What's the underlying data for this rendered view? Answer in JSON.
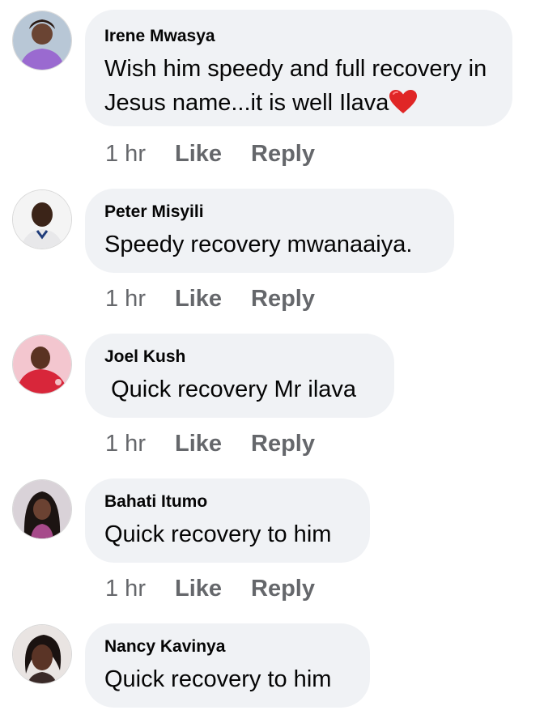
{
  "comments": [
    {
      "author": "Irene Mwasya",
      "text": "Wish him speedy and full recovery in Jesus name...it is well Ilava",
      "emoji_icon": "red-heart-icon",
      "time": "1 hr",
      "like_label": "Like",
      "reply_label": "Reply"
    },
    {
      "author": "Peter Misyili",
      "text": "Speedy recovery mwanaaiya.",
      "time": "1 hr",
      "like_label": "Like",
      "reply_label": "Reply"
    },
    {
      "author": "Joel Kush",
      "text": " Quick recovery Mr ilava",
      "time": "1 hr",
      "like_label": "Like",
      "reply_label": "Reply"
    },
    {
      "author": "Bahati Itumo",
      "text": "Quick recovery to him",
      "time": "1 hr",
      "like_label": "Like",
      "reply_label": "Reply"
    },
    {
      "author": "Nancy Kavinya",
      "text": "Quick recovery to him"
    }
  ],
  "colors": {
    "bubble": "#f0f2f5",
    "meta_text": "#65676b",
    "body_text": "#050505",
    "heart": "#e02626"
  }
}
